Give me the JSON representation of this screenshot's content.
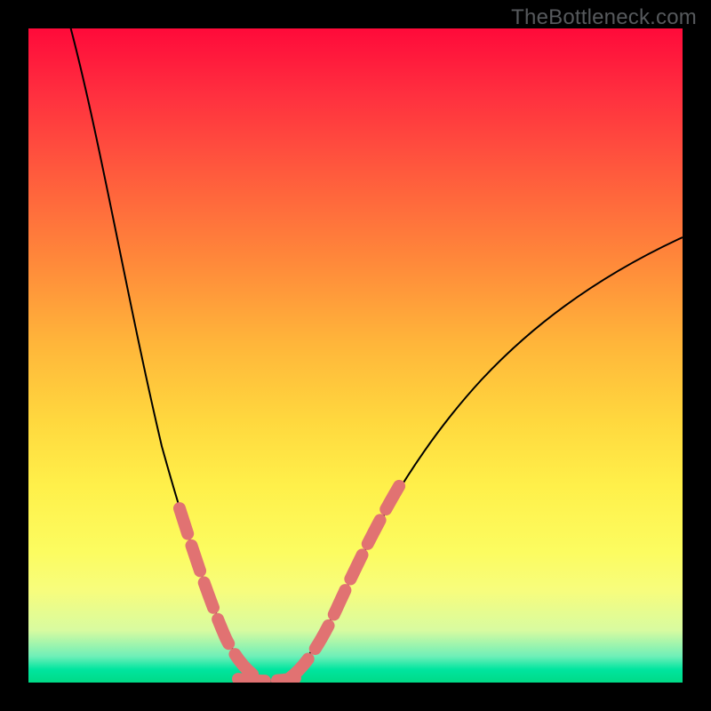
{
  "watermark": "TheBottleneck.com",
  "colors": {
    "frame": "#000000",
    "gradient_top": "#ff0a3a",
    "gradient_bottom": "#00da86",
    "curve": "#000000",
    "marker": "#e17272"
  },
  "chart_data": {
    "type": "line",
    "title": "",
    "xlabel": "",
    "ylabel": "",
    "x": [
      0,
      5,
      10,
      15,
      20,
      25,
      28,
      30,
      32,
      34,
      36,
      38,
      40,
      45,
      50,
      55,
      60,
      70,
      80,
      90,
      100
    ],
    "values": [
      100,
      80,
      58,
      40,
      24,
      10,
      4,
      1,
      0,
      0,
      1,
      3,
      6,
      14,
      22,
      29,
      35,
      44,
      52,
      58,
      63
    ],
    "xlim": [
      0,
      100
    ],
    "ylim": [
      0,
      100
    ],
    "minimum_x": 33,
    "minimum_y": 0,
    "highlight_segments": [
      {
        "x_range": [
          20,
          30
        ],
        "side": "left"
      },
      {
        "x_range": [
          30,
          40
        ],
        "side": "bottom"
      },
      {
        "x_range": [
          40,
          55
        ],
        "side": "right"
      }
    ]
  }
}
